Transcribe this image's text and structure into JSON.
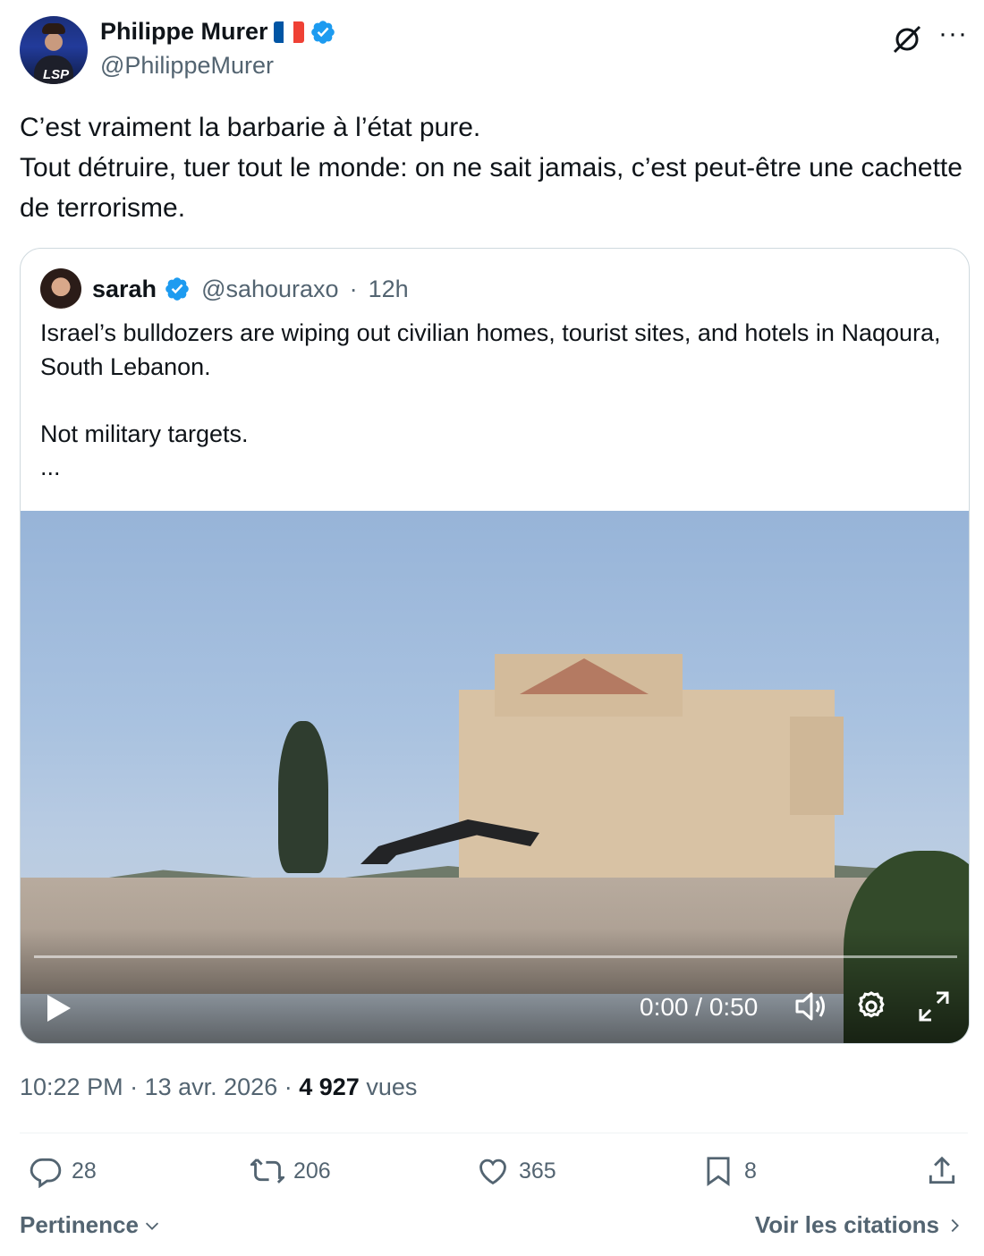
{
  "post": {
    "author_name": "Philippe Murer",
    "author_handle": "@PhilippeMurer",
    "avatar_label": "LSP",
    "text": "C’est vraiment la barbarie à l’état pure.\nTout détruire, tuer tout le monde: on ne sait jamais, c’est peut-être une cachette de terrorisme.",
    "time": "10:22 PM",
    "date": "13 avr. 2026",
    "views_count": "4 927",
    "views_label": "vues"
  },
  "quote": {
    "author_name": "sarah",
    "author_handle": "@sahouraxo",
    "separator": "·",
    "age": "12h",
    "text": "Israel’s bulldozers are wiping out civilian homes, tourist sites, and hotels in Naqoura, South Lebanon.\n\nNot military targets.\n..."
  },
  "video": {
    "time_display": "0:00 / 0:50",
    "progress": 0
  },
  "actions": {
    "replies": "28",
    "reposts": "206",
    "likes": "365",
    "bookmarks": "8"
  },
  "footer": {
    "sort_label": "Pertinence",
    "quotes_link": "Voir les citations"
  },
  "colors": {
    "verified_blue": "#1d9bf0",
    "text_primary": "#0f1419",
    "text_secondary": "#536471",
    "flag": [
      "#0055a4",
      "#ffffff",
      "#ef4135"
    ]
  },
  "icons": [
    "grok-icon",
    "more-icon",
    "verified-icon",
    "play-icon",
    "volume-icon",
    "settings-icon",
    "fullscreen-icon",
    "reply-icon",
    "repost-icon",
    "like-icon",
    "bookmark-icon",
    "share-icon",
    "chevron-down-icon",
    "chevron-right-icon"
  ]
}
